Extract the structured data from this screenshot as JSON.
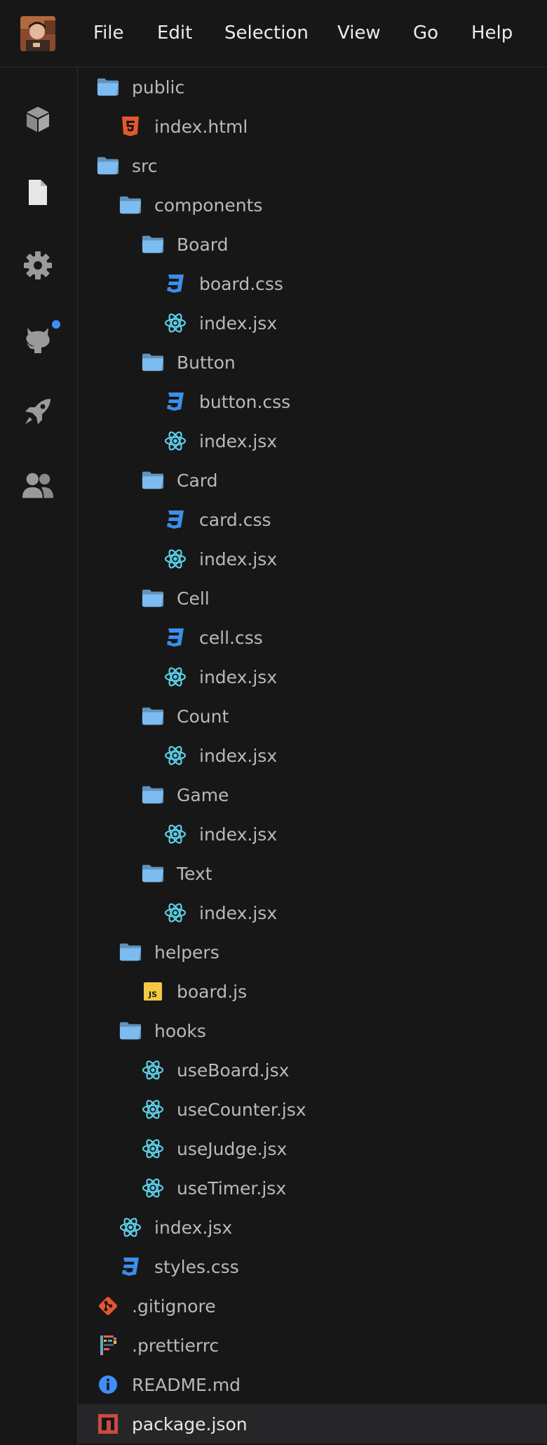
{
  "menu": {
    "items": [
      {
        "label": "File"
      },
      {
        "label": "Edit"
      },
      {
        "label": "Selection"
      },
      {
        "label": "View"
      },
      {
        "label": "Go"
      },
      {
        "label": "Help"
      }
    ]
  },
  "activity_bar": {
    "icons": [
      "cube-icon",
      "file-icon",
      "gear-icon",
      "github-icon",
      "rocket-icon",
      "users-icon"
    ],
    "notification_color": "#3d8ef5"
  },
  "colors": {
    "folder": "#7cbcf0",
    "html": "#e4572e",
    "css": "#3b8eea",
    "react": "#5ccfe6",
    "js": "#f5c842",
    "git": "#e4572e",
    "info": "#3d8ef5",
    "npm": "#c94b3e"
  },
  "tree": [
    {
      "label": "public",
      "type": "folder",
      "depth": 0
    },
    {
      "label": "index.html",
      "type": "html",
      "depth": 1
    },
    {
      "label": "src",
      "type": "folder",
      "depth": 0
    },
    {
      "label": "components",
      "type": "folder",
      "depth": 1
    },
    {
      "label": "Board",
      "type": "folder",
      "depth": 2
    },
    {
      "label": "board.css",
      "type": "css",
      "depth": 3
    },
    {
      "label": "index.jsx",
      "type": "react",
      "depth": 3
    },
    {
      "label": "Button",
      "type": "folder",
      "depth": 2
    },
    {
      "label": "button.css",
      "type": "css",
      "depth": 3
    },
    {
      "label": "index.jsx",
      "type": "react",
      "depth": 3
    },
    {
      "label": "Card",
      "type": "folder",
      "depth": 2
    },
    {
      "label": "card.css",
      "type": "css",
      "depth": 3
    },
    {
      "label": "index.jsx",
      "type": "react",
      "depth": 3
    },
    {
      "label": "Cell",
      "type": "folder",
      "depth": 2
    },
    {
      "label": "cell.css",
      "type": "css",
      "depth": 3
    },
    {
      "label": "index.jsx",
      "type": "react",
      "depth": 3
    },
    {
      "label": "Count",
      "type": "folder",
      "depth": 2
    },
    {
      "label": "index.jsx",
      "type": "react",
      "depth": 3
    },
    {
      "label": "Game",
      "type": "folder",
      "depth": 2
    },
    {
      "label": "index.jsx",
      "type": "react",
      "depth": 3
    },
    {
      "label": "Text",
      "type": "folder",
      "depth": 2
    },
    {
      "label": "index.jsx",
      "type": "react",
      "depth": 3
    },
    {
      "label": "helpers",
      "type": "folder",
      "depth": 1
    },
    {
      "label": "board.js",
      "type": "js",
      "depth": 2
    },
    {
      "label": "hooks",
      "type": "folder",
      "depth": 1
    },
    {
      "label": "useBoard.jsx",
      "type": "react",
      "depth": 2
    },
    {
      "label": "useCounter.jsx",
      "type": "react",
      "depth": 2
    },
    {
      "label": "useJudge.jsx",
      "type": "react",
      "depth": 2
    },
    {
      "label": "useTimer.jsx",
      "type": "react",
      "depth": 2
    },
    {
      "label": "index.jsx",
      "type": "react",
      "depth": 1
    },
    {
      "label": "styles.css",
      "type": "css",
      "depth": 1
    },
    {
      "label": ".gitignore",
      "type": "git",
      "depth": 0
    },
    {
      "label": ".prettierrc",
      "type": "prettier",
      "depth": 0
    },
    {
      "label": "README.md",
      "type": "info",
      "depth": 0
    },
    {
      "label": "package.json",
      "type": "npm",
      "depth": 0,
      "selected": true
    }
  ]
}
